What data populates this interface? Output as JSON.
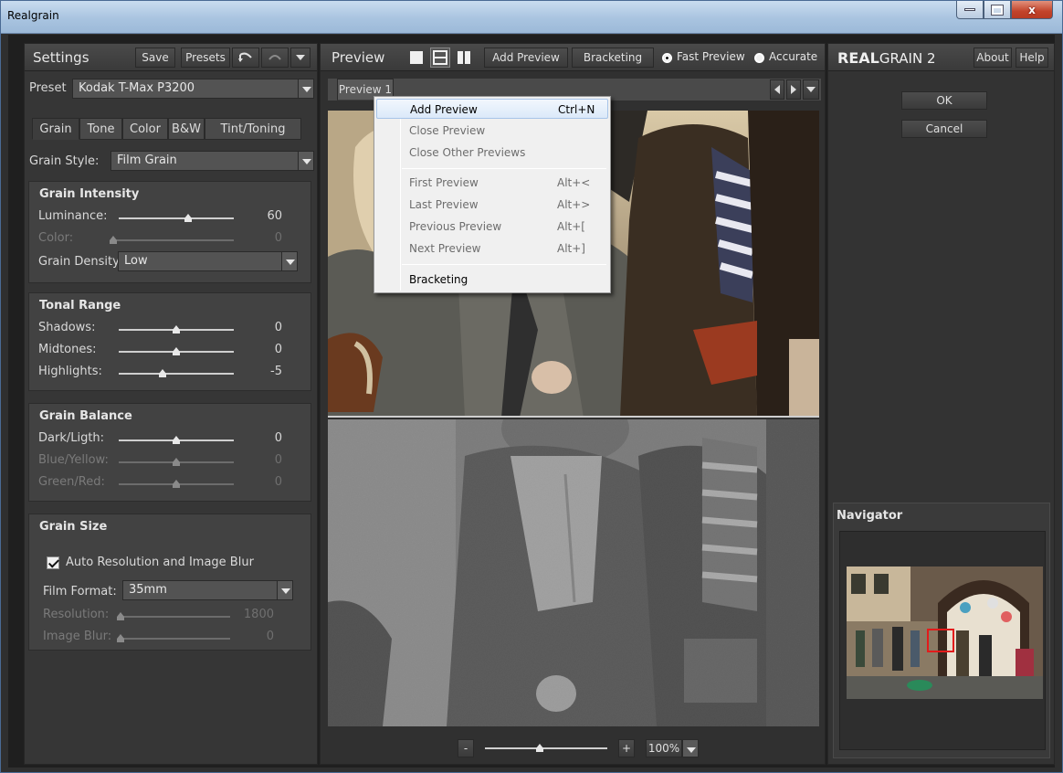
{
  "window": {
    "title": "Realgrain"
  },
  "settings": {
    "title": "Settings",
    "save_label": "Save",
    "presets_label": "Presets",
    "undo_icon": "undo-icon",
    "redo_icon": "redo-icon",
    "preset_label": "Preset",
    "preset_value": "Kodak T-Max P3200",
    "tabs": [
      "Grain",
      "Tone",
      "Color",
      "B&W",
      "Tint/Toning"
    ],
    "active_tab": "Grain",
    "grain_style_label": "Grain Style:",
    "grain_style_value": "Film Grain",
    "grain_intensity": {
      "title": "Grain Intensity",
      "luminance": {
        "label": "Luminance:",
        "value": "60",
        "fraction": 0.6
      },
      "color": {
        "label": "Color:",
        "value": "0",
        "fraction": 0.0
      },
      "density_label": "Grain Density:",
      "density_value": "Low"
    },
    "tonal_range": {
      "title": "Tonal Range",
      "shadows": {
        "label": "Shadows:",
        "value": "0",
        "fraction": 0.5
      },
      "midtones": {
        "label": "Midtones:",
        "value": "0",
        "fraction": 0.5
      },
      "highlights": {
        "label": "Highlights:",
        "value": "-5",
        "fraction": 0.38
      }
    },
    "grain_balance": {
      "title": "Grain Balance",
      "dark_light": {
        "label": "Dark/Ligth:",
        "value": "0",
        "fraction": 0.5
      },
      "blue_yellow": {
        "label": "Blue/Yellow:",
        "value": "0",
        "fraction": 0.5
      },
      "green_red": {
        "label": "Green/Red:",
        "value": "0",
        "fraction": 0.5
      }
    },
    "grain_size": {
      "title": "Grain Size",
      "auto_label": "Auto Resolution and Image Blur",
      "auto_checked": true,
      "film_format_label": "Film Format:",
      "film_format_value": "35mm",
      "resolution": {
        "label": "Resolution:",
        "value": "1800",
        "fraction": 0.0
      },
      "image_blur": {
        "label": "Image Blur:",
        "value": "0",
        "fraction": 0.0
      }
    }
  },
  "preview": {
    "title": "Preview",
    "add_preview_label": "Add Preview",
    "bracketing_label": "Bracketing",
    "fast_preview_label": "Fast Preview",
    "accurate_label": "Accurate",
    "mode": "Fast Preview",
    "tab_label": "Preview 1",
    "zoom_minus": "-",
    "zoom_plus": "+",
    "zoom_value": "100%",
    "zoom_fraction": 0.45
  },
  "context_menu": {
    "items": [
      {
        "label": "Add Preview",
        "shortcut": "Ctrl+N",
        "enabled": true,
        "selected": true
      },
      {
        "label": "Close Preview",
        "shortcut": "",
        "enabled": false
      },
      {
        "label": "Close Other Previews",
        "shortcut": "",
        "enabled": false
      },
      {
        "label": "First Preview",
        "shortcut": "Alt+<",
        "enabled": false
      },
      {
        "label": "Last Preview",
        "shortcut": "Alt+>",
        "enabled": false
      },
      {
        "label": "Previous Preview",
        "shortcut": "Alt+[",
        "enabled": false
      },
      {
        "label": "Next Preview",
        "shortcut": "Alt+]",
        "enabled": false
      },
      {
        "label": "Bracketing",
        "shortcut": "",
        "enabled": true
      }
    ]
  },
  "right_panel": {
    "brand_bold": "REAL",
    "brand_rest": "GRAIN 2",
    "about_label": "About",
    "help_label": "Help",
    "ok_label": "OK",
    "cancel_label": "Cancel",
    "navigator_title": "Navigator"
  }
}
